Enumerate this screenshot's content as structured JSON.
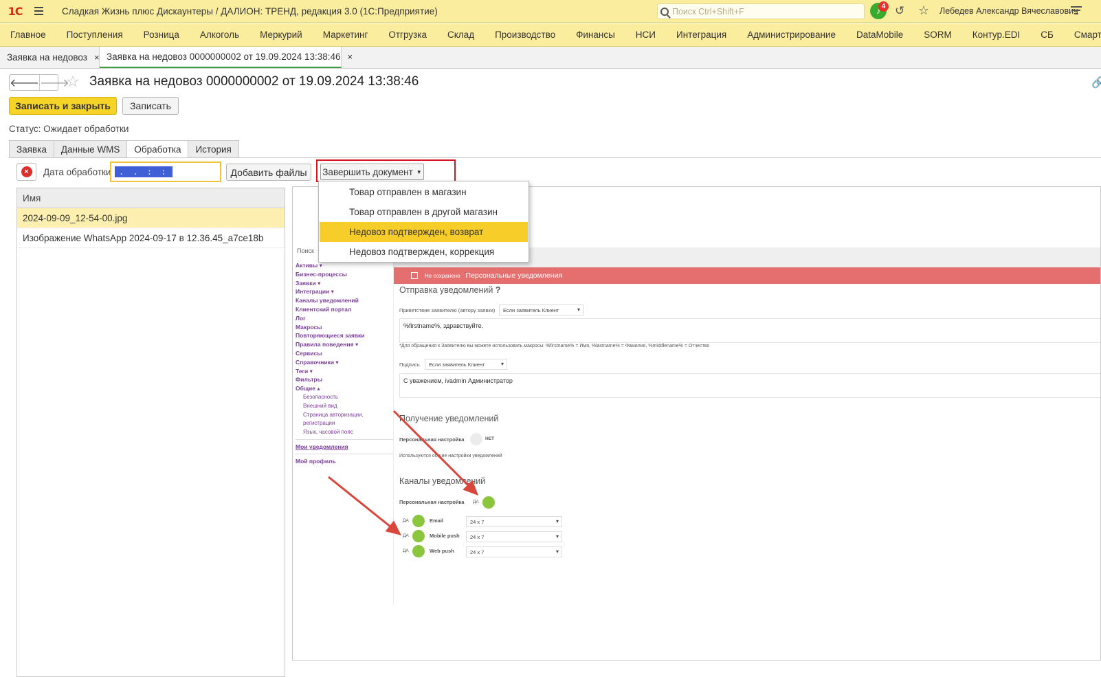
{
  "window": {
    "logo": "1С",
    "title": "Сладкая Жизнь плюс Дискаунтеры / ДАЛИОН: ТРЕНД, редакция 3.0  (1С:Предприятие)",
    "search_placeholder": "Поиск Ctrl+Shift+F",
    "notifications_count": "4",
    "user": "Лебедев Александр Вячеславович"
  },
  "menu": [
    "Главное",
    "Поступления",
    "Розница",
    "Алкоголь",
    "Меркурий",
    "Маркетинг",
    "Отгрузка",
    "Склад",
    "Производство",
    "Финансы",
    "НСИ",
    "Интеграция",
    "Администрирование",
    "DataMobile",
    "SORM",
    "Контур.EDI",
    "СБ",
    "Смарт СВ"
  ],
  "doc_tabs": [
    {
      "label": "Заявка на недовоз",
      "close": "×"
    },
    {
      "label": "Заявка на недовоз 0000000002 от 19.09.2024 13:38:46",
      "close": "×"
    }
  ],
  "form": {
    "title": "Заявка на недовоз 0000000002 от 19.09.2024 13:38:46",
    "save_close": "Записать и закрыть",
    "save": "Записать",
    "status": "Статус: Ожидает обработки",
    "tabs": [
      "Заявка",
      "Данные WMS",
      "Обработка",
      "История"
    ],
    "active_tab": "Обработка"
  },
  "processing": {
    "date_label": "Дата обработки:",
    "date_value": ". .   : :",
    "add_files": "Добавить файлы",
    "finish_doc": "Завершить документ",
    "finish_options": [
      "Товар отправлен в магазин",
      "Товар отправлен в другой магазин",
      "Недовоз подтвержден, возврат",
      "Недовоз подтвержден, коррекция"
    ],
    "highlighted_option": "Недовоз подтвержден, возврат"
  },
  "files": {
    "header": "Имя",
    "rows": [
      "2024-09-09_12-54-00.jpg",
      "Изображение WhatsApp 2024-09-17 в 12.36.45_a7ce18b"
    ]
  },
  "preview": {
    "search": "Поиск",
    "nav": [
      "Активы ▾",
      "Бизнес-процессы",
      "Заявки ▾",
      "Интеграции ▾",
      "Каналы уведомлений",
      "Клиентский портал",
      "Лог",
      "Макросы",
      "Повторяющиеся заявки",
      "Правила поведения ▾",
      "Сервисы",
      "Справочники ▾",
      "Теги ▾",
      "Фильтры",
      "Общие ▴"
    ],
    "nav_sub": [
      "Безопасность",
      "Внешний вид",
      "Страница авторизации, регистрации",
      "Язык, часовой пояс"
    ],
    "nav_my": "Мои уведомления",
    "nav_profile": "Мой профиль",
    "banner_status": "Не сохранено",
    "banner_title": "Персональные уведомления",
    "send_title": "Отправка уведомлений",
    "help_mark": "?",
    "greeting_label": "Приветствие заявителю (автору заявки)",
    "greeting_select": "Если заявитель Клиент",
    "greeting_text": "%firstname%, здравствуйте.",
    "macros_note": "*Для обращения к Заявителю вы можете использовать макросы: %firstname% = Имя, %lastname% = Фамилия, %middlename% = Отчество",
    "sign_label": "Подпись",
    "sign_select": "Если заявитель Клиент",
    "sign_text": "С уважением, ivadmin Администратор",
    "receive_title": "Получение уведомлений",
    "personal_setting": "Персональная настройка",
    "no": "НЕТ",
    "general_used": "Используются общие настройки уведомлений",
    "channels_title": "Каналы уведомлений",
    "yes": "ДА",
    "channels": [
      {
        "name": "Email",
        "schedule": "24 х 7"
      },
      {
        "name": "Mobile push",
        "schedule": "24 х 7"
      },
      {
        "name": "Web push",
        "schedule": "24 х 7"
      }
    ],
    "arrow_color": "#d9473a"
  }
}
